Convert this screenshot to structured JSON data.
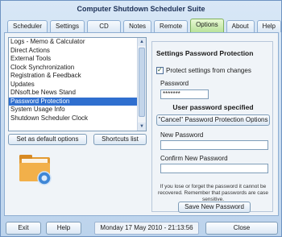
{
  "window": {
    "title": "Computer Shutdown Scheduler Suite"
  },
  "tabs": [
    {
      "label": "Scheduler"
    },
    {
      "label": "Settings"
    },
    {
      "label": "CD Tray"
    },
    {
      "label": "Notes"
    },
    {
      "label": "Remote"
    },
    {
      "label": "Options",
      "active": true
    },
    {
      "label": "About"
    },
    {
      "label": "Help"
    }
  ],
  "options_list": {
    "items": [
      "Logs - Memo & Calculator",
      "Direct Actions",
      "External Tools",
      "Clock Synchronization",
      "Registration & Feedback",
      "Updates",
      "DNsoft.be News Stand",
      "Password Protection",
      "System Usage Info",
      "Shutdown Scheduler Clock"
    ],
    "selected": "Password Protection"
  },
  "left_buttons": {
    "set_default": "Set as default options",
    "shortcuts": "Shortcuts list"
  },
  "password_panel": {
    "title": "Settings Password Protection",
    "protect_checkbox_label": "Protect settings from changes",
    "protect_checked": true,
    "password_label": "Password",
    "password_value": "*******",
    "user_password_heading": "User password specified",
    "cancel_button": "\"Cancel\" Password Protection Options",
    "new_password_label": "New Password",
    "confirm_password_label": "Confirm New Password",
    "note": "If you lose or forget the password it cannot be recovered. Remember that passwords are case sensitive.",
    "save_button": "Save New Password"
  },
  "bottom_bar": {
    "exit": "Exit",
    "help": "Help",
    "datetime": "Monday 17 May 2010 - 21:13:56",
    "close": "Close"
  },
  "colors": {
    "accent_tab": "#b8e29a",
    "selection": "#2f6fcf",
    "background": "#c9dcee"
  }
}
